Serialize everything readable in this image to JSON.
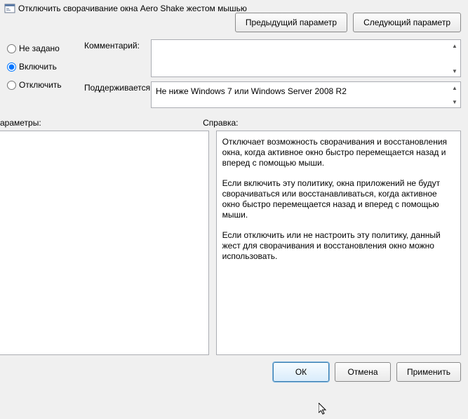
{
  "title": "Отключить сворачивание окна Aero Shake жестом мышью",
  "nav": {
    "prev": "Предыдущий параметр",
    "next": "Следующий параметр"
  },
  "state": {
    "not_configured": "Не задано",
    "enabled": "Включить",
    "disabled": "Отключить",
    "selected": "enabled"
  },
  "fields": {
    "comment_label": "Комментарий:",
    "comment_value": "",
    "supported_label": "Поддерживается:",
    "supported_value": "Не ниже Windows 7 или Windows Server 2008 R2"
  },
  "sections": {
    "params_label": "араметры:",
    "help_label": "Справка:"
  },
  "help": {
    "p1": "Отключает возможность сворачивания и восстановления окна, когда активное окно быстро перемещается назад и вперед с помощью мыши.",
    "p2": "Если включить эту политику, окна приложений не будут сворачиваться или восстанавливаться, когда активное окно быстро перемещается назад и вперед с помощью мыши.",
    "p3": "Если отключить или не настроить эту политику, данный жест для сворачивания и восстановления окно можно использовать."
  },
  "buttons": {
    "ok": "ОК",
    "cancel": "Отмена",
    "apply": "Применить"
  }
}
